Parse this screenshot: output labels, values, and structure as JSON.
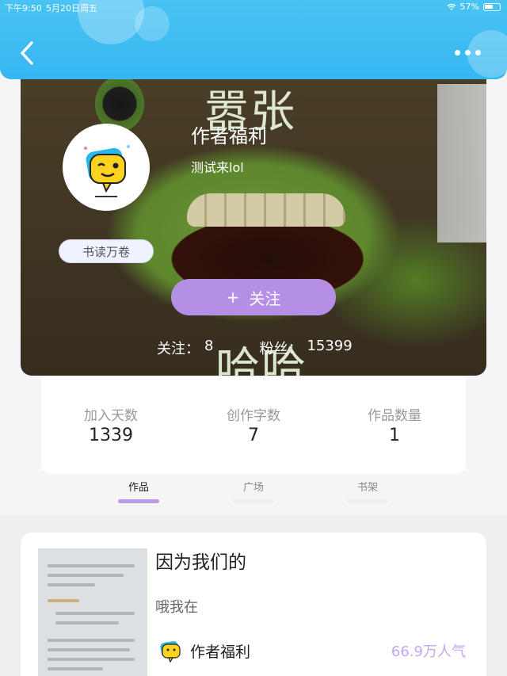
{
  "status_bar": {
    "time": "下午9:50",
    "date": "5月20日周五",
    "battery": "57%"
  },
  "header": {
    "back_icon": "chevron-left-icon",
    "more_icon": "more-dots-icon",
    "color": "#3bb9f2"
  },
  "profile": {
    "name": "作者福利",
    "bio": "测试来lol",
    "badge": "书读万卷",
    "follow_button": "关注",
    "follow_icon": "+",
    "following_label": "关注：",
    "following_count": "8",
    "fans_label": "粉丝：",
    "fans_count": "15399",
    "background_text_top": "嚣张",
    "background_text_bottom": "哈哈",
    "accent_color": "#b58fe6"
  },
  "stats": [
    {
      "label": "加入天数",
      "value": "1339"
    },
    {
      "label": "创作字数",
      "value": "7"
    },
    {
      "label": "作品数量",
      "value": "1"
    }
  ],
  "tabs": [
    {
      "label": "作品",
      "active": true
    },
    {
      "label": "广场",
      "active": false
    },
    {
      "label": "书架",
      "active": false
    }
  ],
  "work": {
    "title": "因为我们的",
    "snippet": "哦我在",
    "author": "作者福利",
    "popularity": "66.9万人气"
  }
}
